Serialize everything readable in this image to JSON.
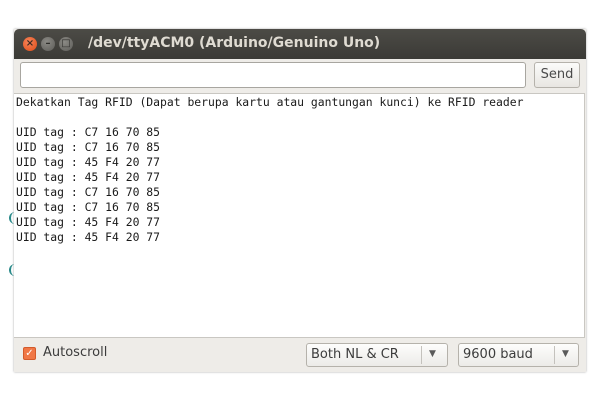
{
  "window": {
    "title": "/dev/ttyACM0 (Arduino/Genuino Uno)"
  },
  "input": {
    "value": "",
    "send_label": "Send"
  },
  "output": {
    "lines": [
      "Dekatkan Tag RFID (Dapat berupa kartu atau gantungan kunci) ke RFID reader",
      "",
      "UID tag : C7 16 70 85",
      "UID tag : C7 16 70 85",
      "UID tag : 45 F4 20 77",
      "UID tag : 45 F4 20 77",
      "UID tag : C7 16 70 85",
      "UID tag : C7 16 70 85",
      "UID tag : 45 F4 20 77",
      "UID tag : 45 F4 20 77"
    ]
  },
  "bottom": {
    "autoscroll_label": "Autoscroll",
    "autoscroll_checked": true,
    "line_ending": "Both NL & CR",
    "baud_rate": "9600 baud"
  },
  "colors": {
    "titlebar": "#3f3e3a",
    "accent": "#f07746",
    "window_bg": "#eeece8"
  },
  "icons": {
    "close": "close-icon",
    "minimize": "minimize-icon",
    "maximize": "maximize-icon",
    "dropdown": "chevron-down-icon",
    "check": "checkmark-icon"
  }
}
